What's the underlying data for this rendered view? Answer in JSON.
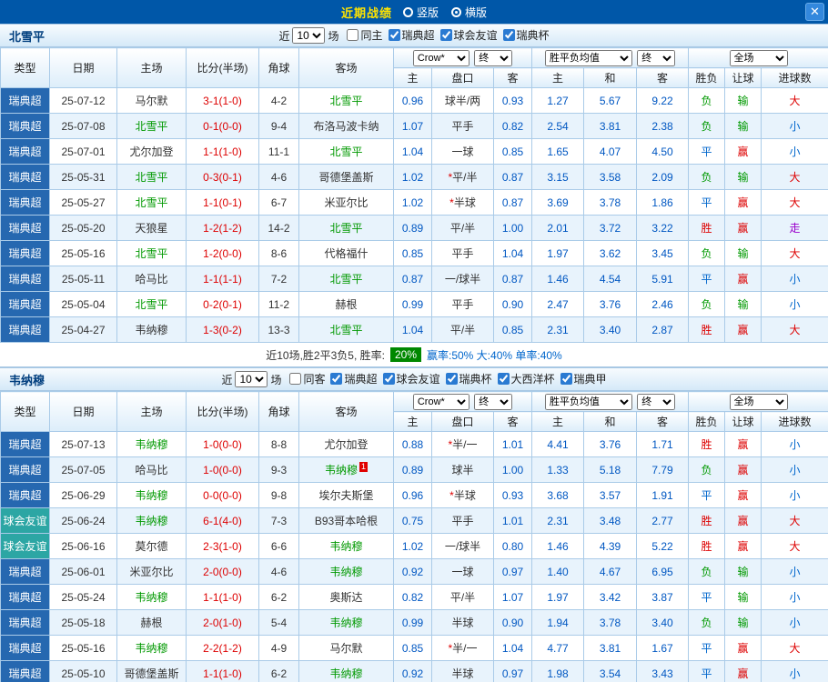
{
  "topbar": {
    "title": "近期战绩",
    "layout_options": [
      {
        "label": "竖版",
        "selected": false
      },
      {
        "label": "横版",
        "selected": true
      }
    ],
    "close_icon": "✕"
  },
  "colors": {
    "topbar_bg": "#0057A8",
    "title_text": "#FFE400",
    "league_super": "#2668B0",
    "league_friendly": "#2CA6A4",
    "win": "#DD0000",
    "draw": "#0066CC",
    "lose": "#009900",
    "walk": "#9900CC",
    "team_focus": "#009900",
    "score": "#DD0000",
    "odds": "#0057C2",
    "win_rate_badge_bg": "#008800"
  },
  "table_header": {
    "type": "类型",
    "date": "日期",
    "home": "主场",
    "score": "比分(半场)",
    "corner": "角球",
    "away": "客场",
    "bookmaker": "Crow*",
    "final": "终",
    "odds_home": "主",
    "handicap": "盘口",
    "odds_away": "客",
    "avg": "胜平负均值",
    "avg_final": "终",
    "avg_home": "主",
    "avg_draw": "和",
    "avg_away": "客",
    "scope": "全场",
    "result": "胜负",
    "let_ball": "让球",
    "goals": "进球数"
  },
  "sections": [
    {
      "team": "北雪平",
      "filter": {
        "near": "近",
        "count": "10",
        "games": "场",
        "checkboxes": [
          {
            "label": "同主",
            "checked": false
          },
          {
            "label": "瑞典超",
            "checked": true
          },
          {
            "label": "球会友谊",
            "checked": true
          },
          {
            "label": "瑞典杯",
            "checked": true
          }
        ]
      },
      "rows": [
        {
          "league": "瑞典超",
          "date": "25-07-12",
          "home": "马尔默",
          "home_focus": false,
          "score": "3-1(1-0)",
          "corner": "4-2",
          "away": "北雪平",
          "away_focus": true,
          "red_card": "",
          "crow_home": "0.96",
          "handicap": "球半/两",
          "crow_away": "0.93",
          "avg_home": "1.27",
          "avg_draw": "5.67",
          "avg_away": "9.22",
          "result": "负",
          "let_ball": "输",
          "goals": "大"
        },
        {
          "league": "瑞典超",
          "date": "25-07-08",
          "home": "北雪平",
          "home_focus": true,
          "score": "0-1(0-0)",
          "corner": "9-4",
          "away": "布洛马波卡纳",
          "away_focus": false,
          "red_card": "",
          "crow_home": "1.07",
          "handicap": "平手",
          "crow_away": "0.82",
          "avg_home": "2.54",
          "avg_draw": "3.81",
          "avg_away": "2.38",
          "result": "负",
          "let_ball": "输",
          "goals": "小"
        },
        {
          "league": "瑞典超",
          "date": "25-07-01",
          "home": "尤尔加登",
          "home_focus": false,
          "score": "1-1(1-0)",
          "corner": "11-1",
          "away": "北雪平",
          "away_focus": true,
          "red_card": "",
          "crow_home": "1.04",
          "handicap": "一球",
          "crow_away": "0.85",
          "avg_home": "1.65",
          "avg_draw": "4.07",
          "avg_away": "4.50",
          "result": "平",
          "let_ball": "赢",
          "goals": "小"
        },
        {
          "league": "瑞典超",
          "date": "25-05-31",
          "home": "北雪平",
          "home_focus": true,
          "score": "0-3(0-1)",
          "corner": "4-6",
          "away": "哥德堡盖斯",
          "away_focus": false,
          "red_card": "",
          "crow_home": "1.02",
          "handicap": "*平/半",
          "crow_away": "0.87",
          "avg_home": "3.15",
          "avg_draw": "3.58",
          "avg_away": "2.09",
          "result": "负",
          "let_ball": "输",
          "goals": "大"
        },
        {
          "league": "瑞典超",
          "date": "25-05-27",
          "home": "北雪平",
          "home_focus": true,
          "score": "1-1(0-1)",
          "corner": "6-7",
          "away": "米亚尔比",
          "away_focus": false,
          "red_card": "",
          "crow_home": "1.02",
          "handicap": "*半球",
          "crow_away": "0.87",
          "avg_home": "3.69",
          "avg_draw": "3.78",
          "avg_away": "1.86",
          "result": "平",
          "let_ball": "赢",
          "goals": "大"
        },
        {
          "league": "瑞典超",
          "date": "25-05-20",
          "home": "天狼星",
          "home_focus": false,
          "score": "1-2(1-2)",
          "corner": "14-2",
          "away": "北雪平",
          "away_focus": true,
          "red_card": "",
          "crow_home": "0.89",
          "handicap": "平/半",
          "crow_away": "1.00",
          "avg_home": "2.01",
          "avg_draw": "3.72",
          "avg_away": "3.22",
          "result": "胜",
          "let_ball": "赢",
          "goals": "走"
        },
        {
          "league": "瑞典超",
          "date": "25-05-16",
          "home": "北雪平",
          "home_focus": true,
          "score": "1-2(0-0)",
          "corner": "8-6",
          "away": "代格福什",
          "away_focus": false,
          "red_card": "",
          "crow_home": "0.85",
          "handicap": "平手",
          "crow_away": "1.04",
          "avg_home": "1.97",
          "avg_draw": "3.62",
          "avg_away": "3.45",
          "result": "负",
          "let_ball": "输",
          "goals": "大"
        },
        {
          "league": "瑞典超",
          "date": "25-05-11",
          "home": "哈马比",
          "home_focus": false,
          "score": "1-1(1-1)",
          "corner": "7-2",
          "away": "北雪平",
          "away_focus": true,
          "red_card": "",
          "crow_home": "0.87",
          "handicap": "一/球半",
          "crow_away": "0.87",
          "avg_home": "1.46",
          "avg_draw": "4.54",
          "avg_away": "5.91",
          "result": "平",
          "let_ball": "赢",
          "goals": "小"
        },
        {
          "league": "瑞典超",
          "date": "25-05-04",
          "home": "北雪平",
          "home_focus": true,
          "score": "0-2(0-1)",
          "corner": "11-2",
          "away": "赫根",
          "away_focus": false,
          "red_card": "",
          "crow_home": "0.99",
          "handicap": "平手",
          "crow_away": "0.90",
          "avg_home": "2.47",
          "avg_draw": "3.76",
          "avg_away": "2.46",
          "result": "负",
          "let_ball": "输",
          "goals": "小"
        },
        {
          "league": "瑞典超",
          "date": "25-04-27",
          "home": "韦纳穆",
          "home_focus": false,
          "score": "1-3(0-2)",
          "corner": "13-3",
          "away": "北雪平",
          "away_focus": true,
          "red_card": "",
          "crow_home": "1.04",
          "handicap": "平/半",
          "crow_away": "0.85",
          "avg_home": "2.31",
          "avg_draw": "3.40",
          "avg_away": "2.87",
          "result": "胜",
          "let_ball": "赢",
          "goals": "大"
        }
      ],
      "summary": {
        "prefix": "近10场,胜2平3负5, 胜率:",
        "win_rate": "20%",
        "stats": "赢率:50%  大:40%  单率:40%"
      }
    },
    {
      "team": "韦纳穆",
      "filter": {
        "near": "近",
        "count": "10",
        "games": "场",
        "checkboxes": [
          {
            "label": "同客",
            "checked": false
          },
          {
            "label": "瑞典超",
            "checked": true
          },
          {
            "label": "球会友谊",
            "checked": true
          },
          {
            "label": "瑞典杯",
            "checked": true
          },
          {
            "label": "大西洋杯",
            "checked": true
          },
          {
            "label": "瑞典甲",
            "checked": true
          }
        ]
      },
      "rows": [
        {
          "league": "瑞典超",
          "date": "25-07-13",
          "home": "韦纳穆",
          "home_focus": true,
          "score": "1-0(0-0)",
          "corner": "8-8",
          "away": "尤尔加登",
          "away_focus": false,
          "red_card": "",
          "crow_home": "0.88",
          "handicap": "*半/一",
          "crow_away": "1.01",
          "avg_home": "4.41",
          "avg_draw": "3.76",
          "avg_away": "1.71",
          "result": "胜",
          "let_ball": "赢",
          "goals": "小"
        },
        {
          "league": "瑞典超",
          "date": "25-07-05",
          "home": "哈马比",
          "home_focus": false,
          "score": "1-0(0-0)",
          "corner": "9-3",
          "away": "韦纳穆",
          "away_focus": true,
          "red_card": "1",
          "crow_home": "0.89",
          "handicap": "球半",
          "crow_away": "1.00",
          "avg_home": "1.33",
          "avg_draw": "5.18",
          "avg_away": "7.79",
          "result": "负",
          "let_ball": "赢",
          "goals": "小"
        },
        {
          "league": "瑞典超",
          "date": "25-06-29",
          "home": "韦纳穆",
          "home_focus": true,
          "score": "0-0(0-0)",
          "corner": "9-8",
          "away": "埃尔夫斯堡",
          "away_focus": false,
          "red_card": "",
          "crow_home": "0.96",
          "handicap": "*半球",
          "crow_away": "0.93",
          "avg_home": "3.68",
          "avg_draw": "3.57",
          "avg_away": "1.91",
          "result": "平",
          "let_ball": "赢",
          "goals": "小"
        },
        {
          "league": "球会友谊",
          "date": "25-06-24",
          "home": "韦纳穆",
          "home_focus": true,
          "score": "6-1(4-0)",
          "corner": "7-3",
          "away": "B93哥本哈根",
          "away_focus": false,
          "red_card": "",
          "crow_home": "0.75",
          "handicap": "平手",
          "crow_away": "1.01",
          "avg_home": "2.31",
          "avg_draw": "3.48",
          "avg_away": "2.77",
          "result": "胜",
          "let_ball": "赢",
          "goals": "大"
        },
        {
          "league": "球会友谊",
          "date": "25-06-16",
          "home": "莫尔德",
          "home_focus": false,
          "score": "2-3(1-0)",
          "corner": "6-6",
          "away": "韦纳穆",
          "away_focus": true,
          "red_card": "",
          "crow_home": "1.02",
          "handicap": "一/球半",
          "crow_away": "0.80",
          "avg_home": "1.46",
          "avg_draw": "4.39",
          "avg_away": "5.22",
          "result": "胜",
          "let_ball": "赢",
          "goals": "大"
        },
        {
          "league": "瑞典超",
          "date": "25-06-01",
          "home": "米亚尔比",
          "home_focus": false,
          "score": "2-0(0-0)",
          "corner": "4-6",
          "away": "韦纳穆",
          "away_focus": true,
          "red_card": "",
          "crow_home": "0.92",
          "handicap": "一球",
          "crow_away": "0.97",
          "avg_home": "1.40",
          "avg_draw": "4.67",
          "avg_away": "6.95",
          "result": "负",
          "let_ball": "输",
          "goals": "小"
        },
        {
          "league": "瑞典超",
          "date": "25-05-24",
          "home": "韦纳穆",
          "home_focus": true,
          "score": "1-1(1-0)",
          "corner": "6-2",
          "away": "奥斯达",
          "away_focus": false,
          "red_card": "",
          "crow_home": "0.82",
          "handicap": "平/半",
          "crow_away": "1.07",
          "avg_home": "1.97",
          "avg_draw": "3.42",
          "avg_away": "3.87",
          "result": "平",
          "let_ball": "输",
          "goals": "小"
        },
        {
          "league": "瑞典超",
          "date": "25-05-18",
          "home": "赫根",
          "home_focus": false,
          "score": "2-0(1-0)",
          "corner": "5-4",
          "away": "韦纳穆",
          "away_focus": true,
          "red_card": "",
          "crow_home": "0.99",
          "handicap": "半球",
          "crow_away": "0.90",
          "avg_home": "1.94",
          "avg_draw": "3.78",
          "avg_away": "3.40",
          "result": "负",
          "let_ball": "输",
          "goals": "小"
        },
        {
          "league": "瑞典超",
          "date": "25-05-16",
          "home": "韦纳穆",
          "home_focus": true,
          "score": "2-2(1-2)",
          "corner": "4-9",
          "away": "马尔默",
          "away_focus": false,
          "red_card": "",
          "crow_home": "0.85",
          "handicap": "*半/一",
          "crow_away": "1.04",
          "avg_home": "4.77",
          "avg_draw": "3.81",
          "avg_away": "1.67",
          "result": "平",
          "let_ball": "赢",
          "goals": "大"
        },
        {
          "league": "瑞典超",
          "date": "25-05-10",
          "home": "哥德堡盖斯",
          "home_focus": false,
          "score": "1-1(1-0)",
          "corner": "6-2",
          "away": "韦纳穆",
          "away_focus": true,
          "red_card": "",
          "crow_home": "0.92",
          "handicap": "半球",
          "crow_away": "0.97",
          "avg_home": "1.98",
          "avg_draw": "3.54",
          "avg_away": "3.43",
          "result": "平",
          "let_ball": "赢",
          "goals": "小"
        }
      ]
    }
  ]
}
